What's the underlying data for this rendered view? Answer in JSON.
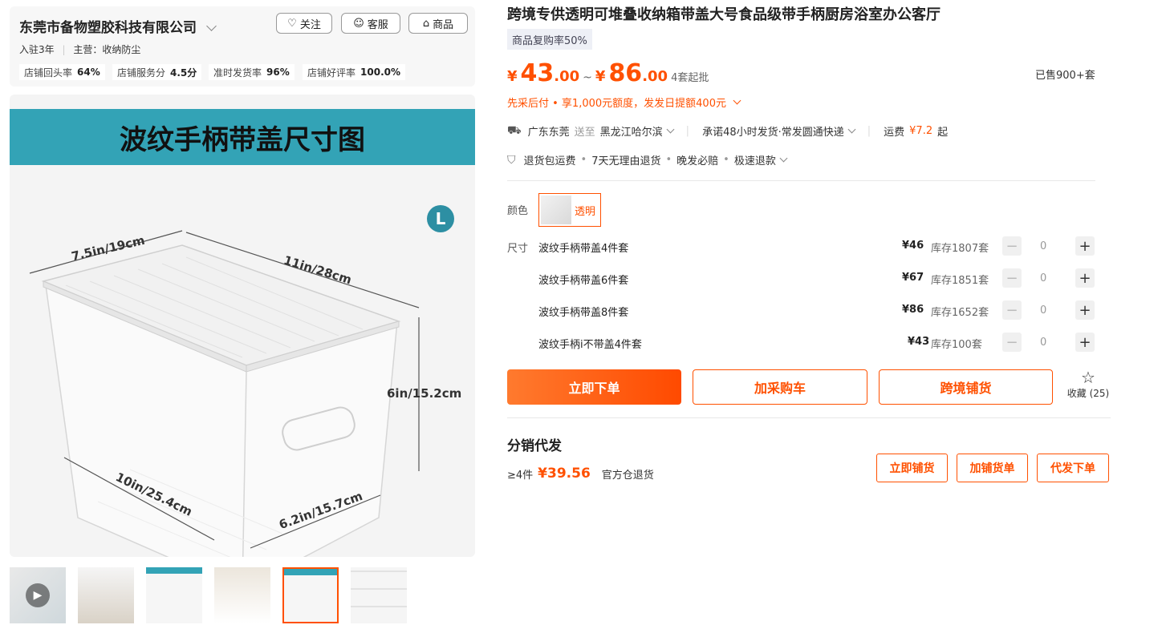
{
  "shop": {
    "name": "东莞市备物塑胶科技有限公司",
    "follow_label": "关注",
    "service_label": "客服",
    "products_label": "商品",
    "years": "入驻3年",
    "main_business": "主营：收纳防尘",
    "metrics": [
      {
        "label": "店铺回头率",
        "value": "64%"
      },
      {
        "label": "店铺服务分",
        "value": "4.5分"
      },
      {
        "label": "准时发货率",
        "value": "96%"
      },
      {
        "label": "店铺好评率",
        "value": "100.0%"
      }
    ]
  },
  "main_image": {
    "banner": "波纹手柄带盖尺寸图",
    "badge": "L",
    "dims": {
      "top_left": "7.5in/19cm",
      "top_right": "11in/28cm",
      "right": "6in/15.2cm",
      "bottom_left": "10in/25.4cm",
      "bottom_right": "6.2in/15.7cm"
    }
  },
  "thumbnails": [
    "video",
    "stack",
    "size-chart-teal",
    "shelf",
    "size-chart-selected",
    "grid"
  ],
  "product": {
    "title": "跨境专供透明可堆叠收纳箱带盖大号食品级带手柄厨房浴室办公客厅",
    "tag": "商品复购率50%",
    "price_low_int": "43",
    "price_low_dec": ".00",
    "price_high_int": "86",
    "price_high_dec": ".00",
    "currency": "¥",
    "tilde": "~",
    "min_order": "4套起批",
    "sold": "已售900+套",
    "credit": "先采后付 • 享1,000元额度，发发日提额400元",
    "ship_from": "广东东莞",
    "ship_to_label": "送至",
    "ship_to": "黑龙江哈尔滨",
    "promise": "承诺48小时发货·常发圆通快递",
    "freight_label": "运费",
    "freight_value": "¥7.2",
    "freight_suffix": "起",
    "guarantees": [
      "退货包运费",
      "7天无理由退货",
      "晚发必赔",
      "极速退款"
    ],
    "color_label": "颜色",
    "color_option": "透明",
    "size_label": "尺寸",
    "sizes": [
      {
        "name": "波纹手柄带盖4件套",
        "price": "¥46",
        "stock": "库存1807套",
        "qty": "0"
      },
      {
        "name": "波纹手柄带盖6件套",
        "price": "¥67",
        "stock": "库存1851套",
        "qty": "0"
      },
      {
        "name": "波纹手柄带盖8件套",
        "price": "¥86",
        "stock": "库存1652套",
        "qty": "0"
      },
      {
        "name": "波纹手柄i不带盖4件套",
        "price": "¥43",
        "stock": "库存100套",
        "qty": "0"
      }
    ],
    "buy_now": "立即下单",
    "add_cart": "加采购车",
    "cross_border": "跨境铺货",
    "favorite": "收藏",
    "favorite_count": "(25)"
  },
  "distribution": {
    "title": "分销代发",
    "min_qty": "≥4件",
    "price": "¥39.56",
    "note": "官方仓退货",
    "btn1": "立即铺货",
    "btn2": "加铺货单",
    "btn3": "代发下单"
  },
  "colors": {
    "accent": "#ff5000",
    "banner": "#33a3b6"
  }
}
